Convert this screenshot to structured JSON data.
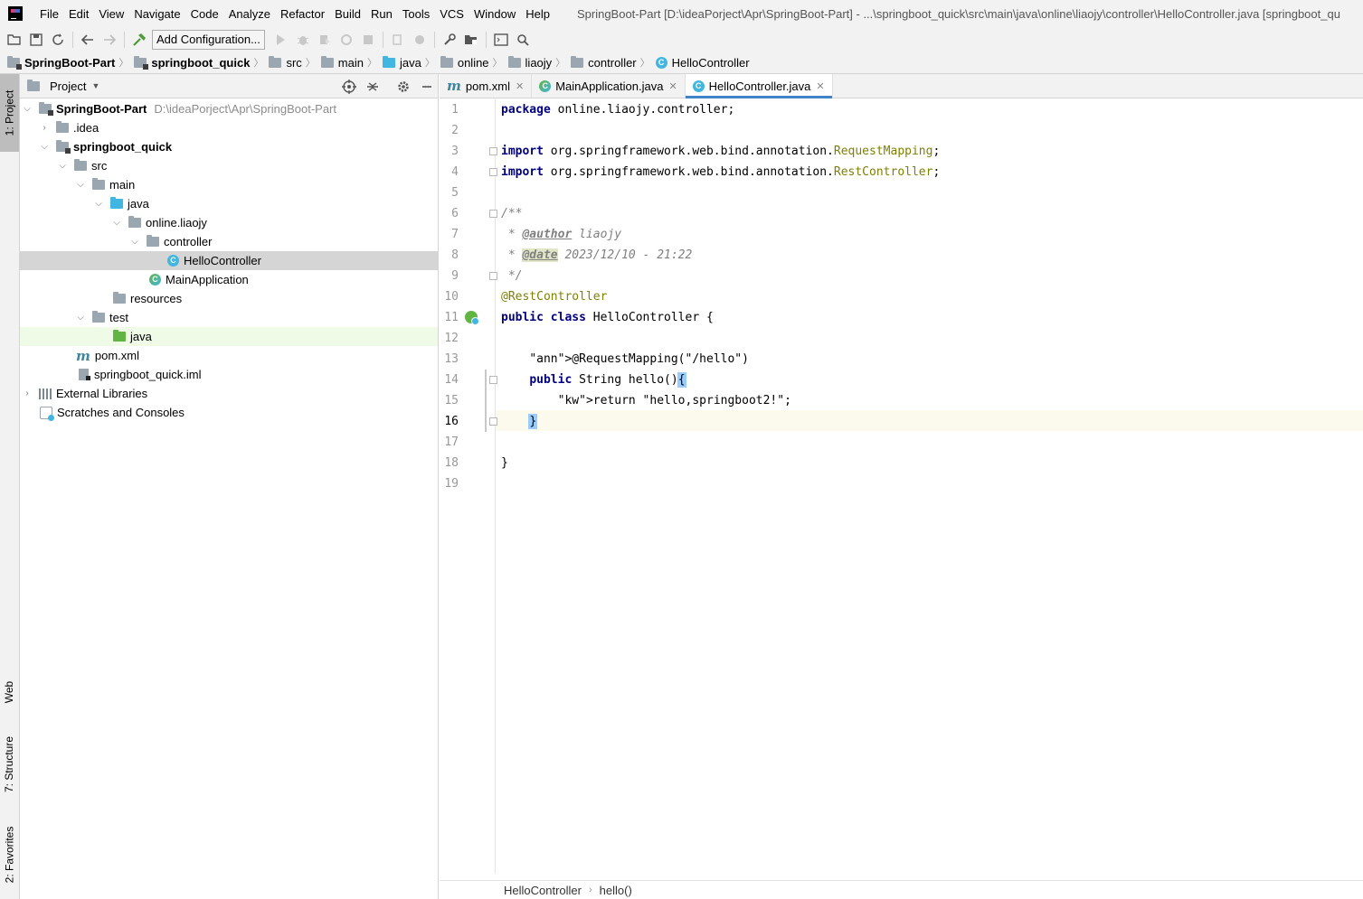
{
  "window": {
    "title": "SpringBoot-Part [D:\\ideaPorject\\Apr\\SpringBoot-Part] - ...\\springboot_quick\\src\\main\\java\\online\\liaojy\\controller\\HelloController.java [springboot_qu"
  },
  "menu": [
    "File",
    "Edit",
    "View",
    "Navigate",
    "Code",
    "Analyze",
    "Refactor",
    "Build",
    "Run",
    "Tools",
    "VCS",
    "Window",
    "Help"
  ],
  "toolbar": {
    "add_configuration": "Add Configuration..."
  },
  "breadcrumb": [
    "SpringBoot-Part",
    "springboot_quick",
    "src",
    "main",
    "java",
    "online",
    "liaojy",
    "controller",
    "HelloController"
  ],
  "left_stripe": {
    "project": "1: Project",
    "web": "Web",
    "structure": "7: Structure",
    "favorites": "2: Favorites"
  },
  "project_panel": {
    "title": "Project",
    "tree": [
      {
        "label": "SpringBoot-Part",
        "path": "D:\\ideaPorject\\Apr\\SpringBoot-Part",
        "bold": true,
        "icon": "module-folder-icon",
        "expanded": true
      },
      {
        "label": ".idea",
        "icon": "folder-icon",
        "expanded": false
      },
      {
        "label": "springboot_quick",
        "bold": true,
        "icon": "module-folder-icon",
        "expanded": true
      },
      {
        "label": "src",
        "icon": "folder-icon",
        "expanded": true
      },
      {
        "label": "main",
        "icon": "folder-icon",
        "expanded": true
      },
      {
        "label": "java",
        "icon": "source-folder-icon",
        "expanded": true
      },
      {
        "label": "online.liaojy",
        "icon": "package-icon",
        "expanded": true
      },
      {
        "label": "controller",
        "icon": "package-icon",
        "expanded": true
      },
      {
        "label": "HelloController",
        "icon": "class-icon",
        "selected": true
      },
      {
        "label": "MainApplication",
        "icon": "spring-class-icon"
      },
      {
        "label": "resources",
        "icon": "resources-folder-icon"
      },
      {
        "label": "test",
        "icon": "folder-icon",
        "expanded": true
      },
      {
        "label": "java",
        "icon": "test-folder-icon",
        "highlighted": true
      },
      {
        "label": "pom.xml",
        "icon": "maven-icon"
      },
      {
        "label": "springboot_quick.iml",
        "icon": "iml-file-icon"
      },
      {
        "label": "External Libraries",
        "icon": "libraries-icon",
        "expanded": false
      },
      {
        "label": "Scratches and Consoles",
        "icon": "scratches-icon"
      }
    ]
  },
  "tabs": [
    {
      "label": "pom.xml",
      "icon": "maven-icon",
      "active": false
    },
    {
      "label": "MainApplication.java",
      "icon": "spring-class-icon",
      "active": false
    },
    {
      "label": "HelloController.java",
      "icon": "class-icon",
      "active": true
    }
  ],
  "editor": {
    "current_line": 16,
    "lines": [
      "package online.liaojy.controller;",
      "",
      "import org.springframework.web.bind.annotation.RequestMapping;",
      "import org.springframework.web.bind.annotation.RestController;",
      "",
      "/**",
      " * @author liaojy",
      " * @date 2023/12/10 - 21:22",
      " */",
      "@RestController",
      "public class HelloController {",
      "",
      "    @RequestMapping(\"/hello\")",
      "    public String hello(){",
      "        return \"hello,springboot2!\";",
      "    }",
      "",
      "}",
      ""
    ],
    "line_numbers": [
      "1",
      "2",
      "3",
      "4",
      "5",
      "6",
      "7",
      "8",
      "9",
      "10",
      "11",
      "12",
      "13",
      "14",
      "15",
      "16",
      "17",
      "18",
      "19"
    ]
  },
  "editor_breadcrumb": [
    "HelloController",
    "hello()"
  ],
  "colors": {
    "keyword": "#000080",
    "annotation": "#808000",
    "string": "#008000",
    "comment": "#808080",
    "active_tab_underline": "#4083c9",
    "selection": "#d5d5d5",
    "current_line": "#fcfaed"
  }
}
